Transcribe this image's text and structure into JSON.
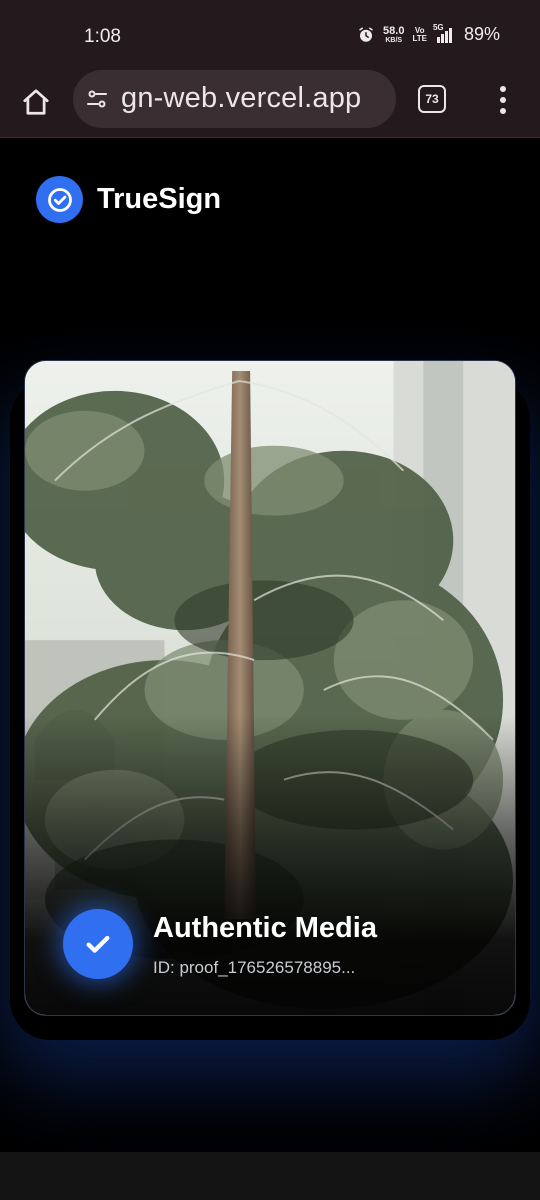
{
  "status_bar": {
    "time": "1:08",
    "net_speed_value": "58.0",
    "net_speed_unit": "KB/S",
    "volte_top": "Vo",
    "volte_bottom": "LTE",
    "network_type": "5G",
    "battery": "89%",
    "icons": [
      "alarm-icon",
      "signal-icon"
    ]
  },
  "browser": {
    "url": "gn-web.vercel.app",
    "tab_count": "73",
    "icons": [
      "home-icon",
      "site-settings-icon",
      "tabs-icon",
      "menu-icon"
    ]
  },
  "app": {
    "brand_name": "TrueSign",
    "accent_color": "#2f6ff0"
  },
  "media_card": {
    "title": "Authentic Media",
    "proof_id": "ID: proof_176526578895..."
  }
}
